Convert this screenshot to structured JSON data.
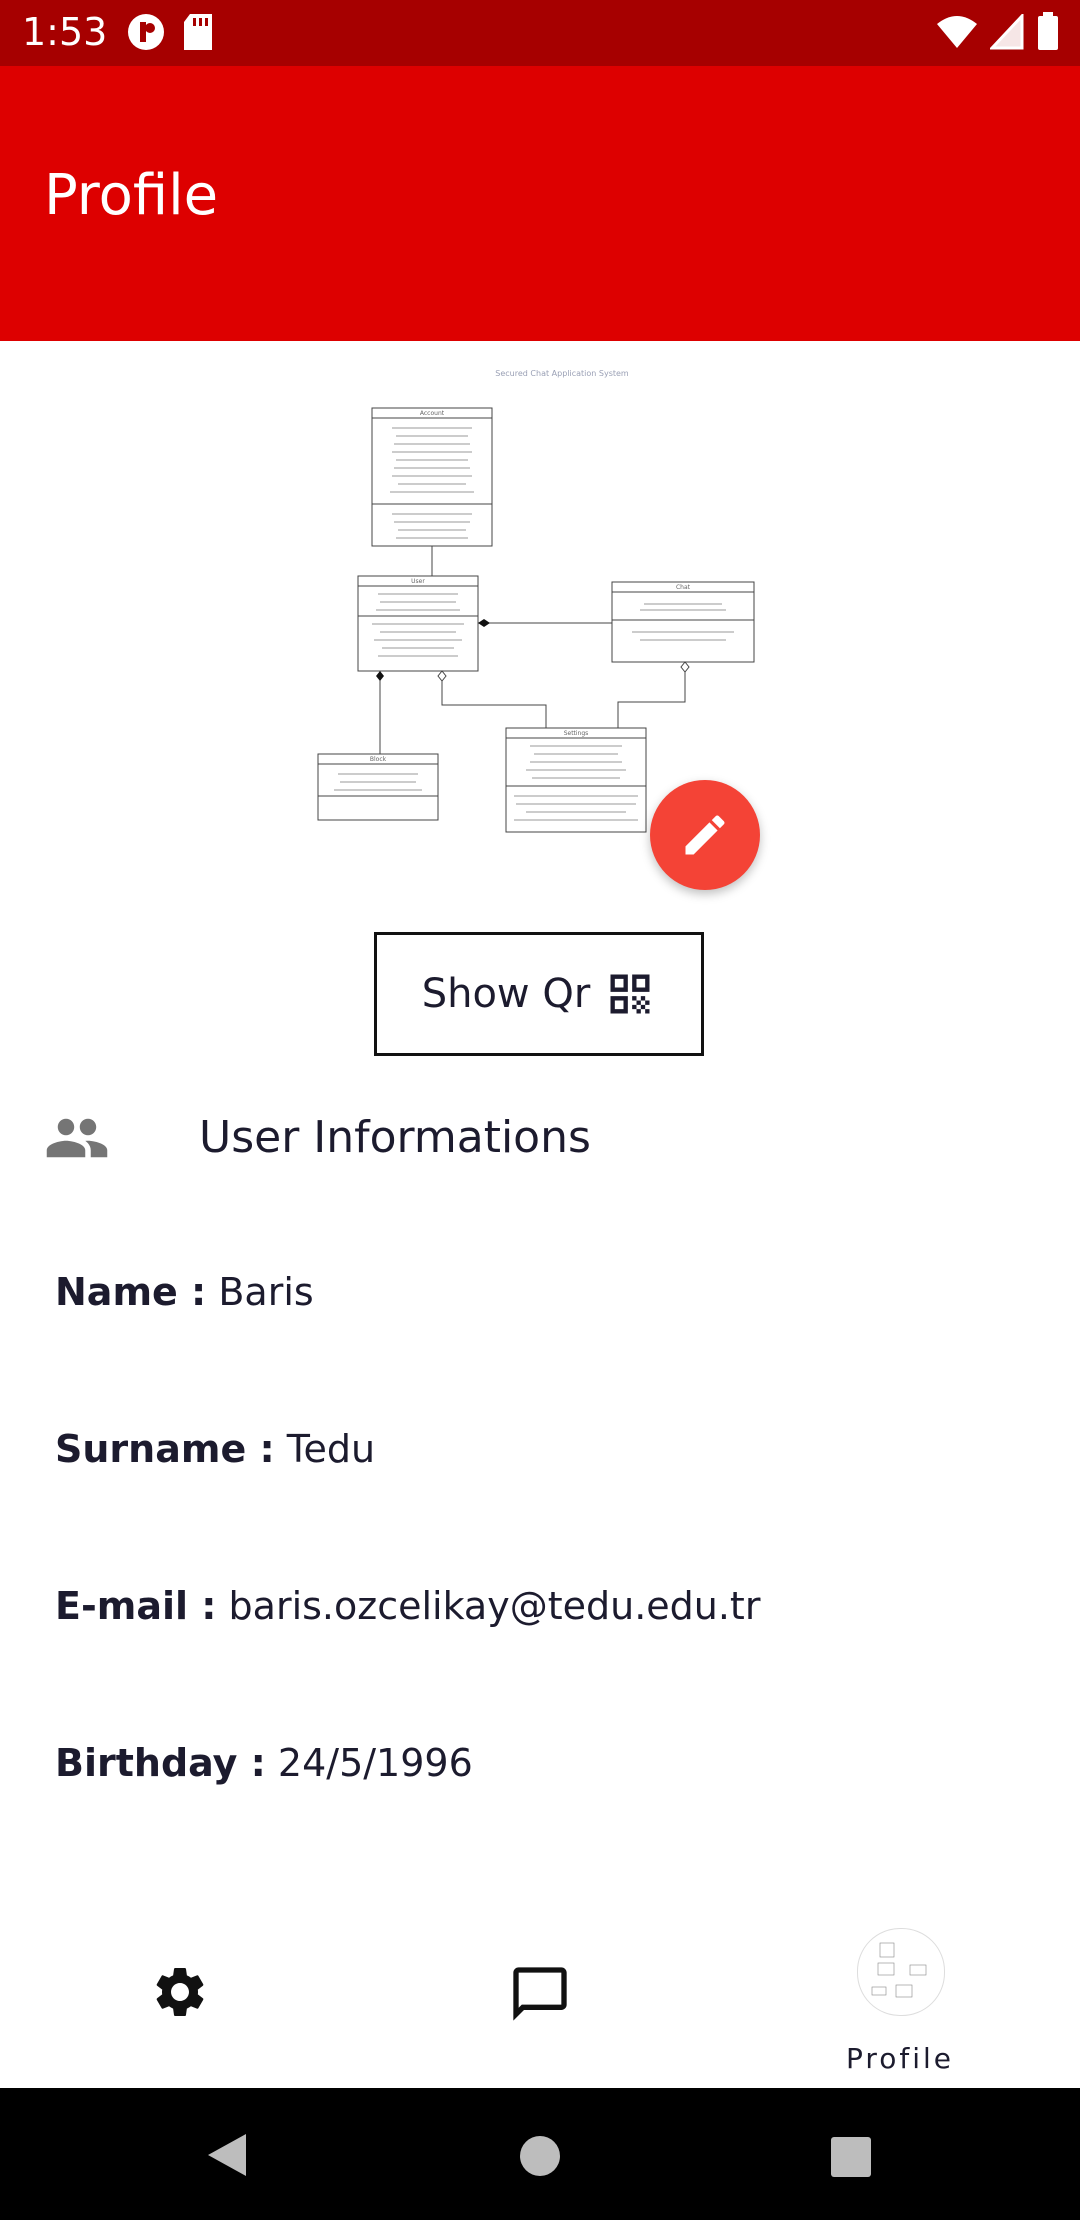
{
  "status_bar": {
    "time": "1:53"
  },
  "app_bar": {
    "title": "Profile"
  },
  "profile_image": {
    "diagram_title": "Secured Chat Application System",
    "classes": {
      "account": "Account",
      "user": "User",
      "chat": "Chat",
      "block": "Block",
      "settings": "Settings"
    }
  },
  "show_qr": {
    "label": "Show Qr"
  },
  "section": {
    "title": "User Informations"
  },
  "info": {
    "name": {
      "label": "Name :",
      "value": "Baris"
    },
    "surname": {
      "label": "Surname :",
      "value": "Tedu"
    },
    "email": {
      "label": "E-mail :",
      "value": "baris.ozcelikay@tedu.edu.tr"
    },
    "birthday": {
      "label": "Birthday :",
      "value": "24/5/1996"
    }
  },
  "bottom_nav": {
    "profile_label": "Profile"
  },
  "colors": {
    "status_bar": "#a60000",
    "app_bar": "#dd0000",
    "fab": "#f44336",
    "text": "#1c1b2e"
  }
}
